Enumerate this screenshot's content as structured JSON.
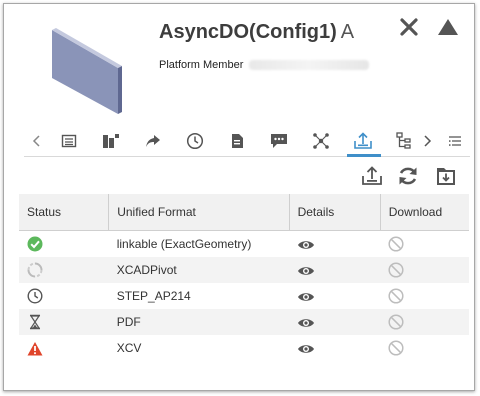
{
  "header": {
    "object_name": "AsyncDO(Config1)",
    "revision": "A",
    "meta_label": "Platform Member",
    "thumbnail_icon": "3d-part-thumbnail-icon",
    "close_icon": "close-icon",
    "collapse_icon": "collapse-triangle-icon"
  },
  "tabs": {
    "icons": [
      "chevron-left-icon",
      "properties-icon",
      "relations-icon",
      "share-icon",
      "history-icon",
      "document-icon",
      "comments-icon",
      "network-icon",
      "derived-formats-icon",
      "structure-icon",
      "chevron-right-icon",
      "more-icon"
    ],
    "active": "derived-formats-icon",
    "accent": "#3f8fc9"
  },
  "toolbar": {
    "icons": [
      "generate-format-icon",
      "refresh-icon",
      "batch-download-icon"
    ]
  },
  "table": {
    "columns": [
      "Status",
      "Unified Format",
      "Details",
      "Download"
    ],
    "rows": [
      {
        "status_icon": "check-circle-icon",
        "format": "linkable (ExactGeometry)",
        "details_icon": "eye-icon",
        "download_icon": "disabled-icon"
      },
      {
        "status_icon": "pending-icon",
        "format": "XCADPivot",
        "details_icon": "eye-icon",
        "download_icon": "disabled-icon"
      },
      {
        "status_icon": "clock-icon",
        "format": "STEP_AP214",
        "details_icon": "eye-icon",
        "download_icon": "disabled-icon"
      },
      {
        "status_icon": "hourglass-icon",
        "format": "PDF",
        "details_icon": "eye-icon",
        "download_icon": "disabled-icon"
      },
      {
        "status_icon": "warning-icon",
        "format": "XCV",
        "details_icon": "eye-icon",
        "download_icon": "disabled-icon"
      }
    ]
  },
  "colors": {
    "success": "#5cb85c",
    "error": "#e0452b",
    "icon": "#555555",
    "disabled": "#bdbdbd"
  }
}
